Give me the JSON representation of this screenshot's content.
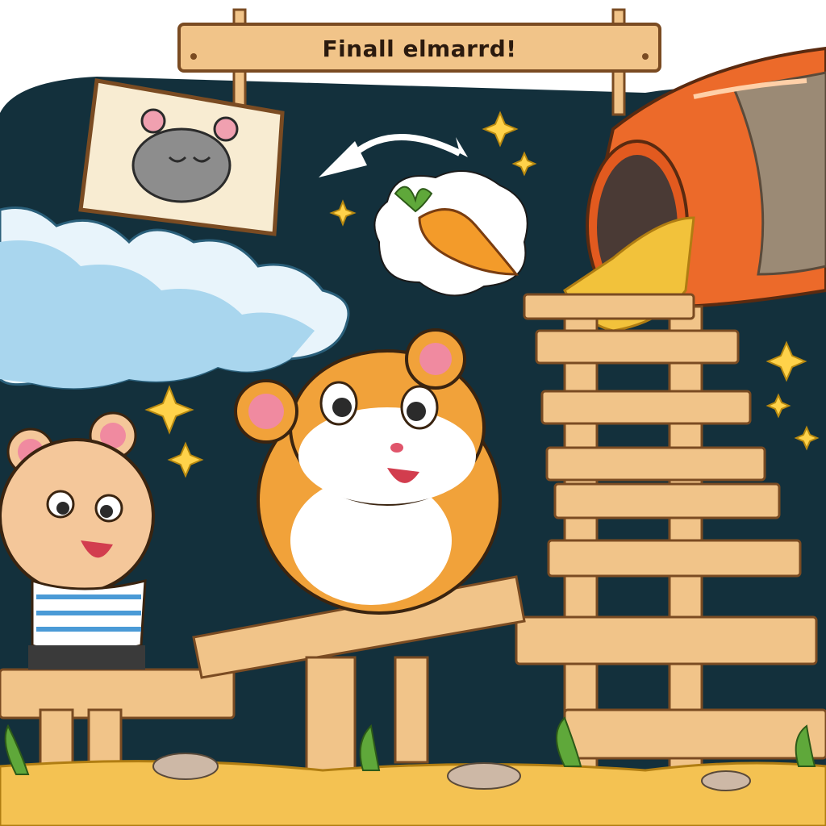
{
  "banner": {
    "text": "Finall elmarrd!"
  },
  "colors": {
    "night_sky": "#13303c",
    "wood": "#f1c489",
    "wood_dark": "#c98d4a",
    "tube": "#ec6a2a",
    "ground": "#f4c252",
    "hamster_main": "#f1a23a",
    "hamster_friend": "#f4c79a",
    "sparkle": "#ffd24a"
  },
  "icons": [
    "carrot-icon",
    "sparkle-icon",
    "arrow-icon"
  ]
}
